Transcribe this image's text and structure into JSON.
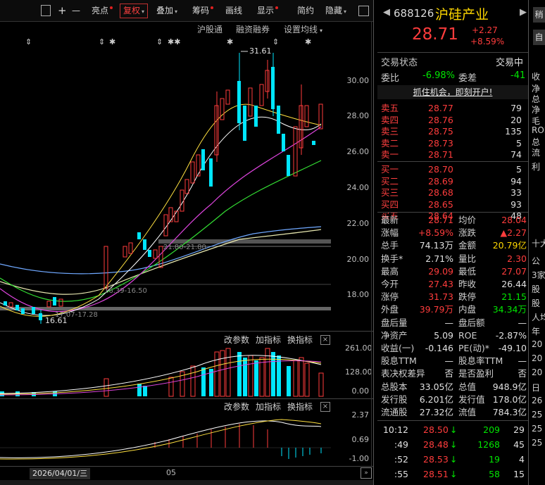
{
  "toolbar": {
    "items": [
      "亮点",
      "复权",
      "叠加",
      "筹码",
      "画线",
      "显示",
      "简约",
      "隐藏"
    ],
    "zoom_in": "+",
    "zoom_out": "—"
  },
  "chart_header": {
    "links": [
      "沪股通",
      "融资融券",
      "设置均线"
    ]
  },
  "axis": {
    "main": [
      "30.00",
      "28.00",
      "26.00",
      "24.00",
      "22.00",
      "20.00",
      "18.00"
    ],
    "vol": [
      "261.00",
      "128.00",
      "0.00"
    ],
    "macd": [
      "2.37",
      "0.69",
      "-1.00"
    ]
  },
  "annotations": {
    "high": "31.61",
    "low": "16.61",
    "level1": "21.80-21.80",
    "level2": "16.39-16.50",
    "level3": "17.07-17.28"
  },
  "sub1": {
    "tabs": [
      "改参数",
      "加指标",
      "换指标"
    ]
  },
  "sub2": {
    "tabs": [
      "改参数",
      "加指标",
      "换指标"
    ]
  },
  "date_axis": {
    "date": "2026/04/01/三",
    "month": "05"
  },
  "stock": {
    "code": "688126",
    "name": "沪硅产业",
    "price": "28.71",
    "change": "+2.27",
    "change_pct": "+8.59%",
    "status_label": "交易状态",
    "status": "交易中",
    "weibi_label": "委比",
    "weibi": "-6.98%",
    "weicha_label": "委差",
    "weicha": "-41",
    "promo": "抓住机会，即刻开户!"
  },
  "order_book": {
    "asks": [
      {
        "label": "卖五",
        "price": "28.77",
        "vol": "79"
      },
      {
        "label": "卖四",
        "price": "28.76",
        "vol": "20"
      },
      {
        "label": "卖三",
        "price": "28.75",
        "vol": "135"
      },
      {
        "label": "卖二",
        "price": "28.73",
        "vol": "5"
      },
      {
        "label": "卖一",
        "price": "28.71",
        "vol": "74"
      }
    ],
    "bids": [
      {
        "label": "买一",
        "price": "28.70",
        "vol": "5"
      },
      {
        "label": "买二",
        "price": "28.69",
        "vol": "94"
      },
      {
        "label": "买三",
        "price": "28.68",
        "vol": "33"
      },
      {
        "label": "买四",
        "price": "28.65",
        "vol": "93"
      },
      {
        "label": "买五",
        "price": "28.64",
        "vol": "48"
      }
    ]
  },
  "quote": [
    {
      "l1": "最新",
      "v1": "28.71",
      "c1": "red",
      "l2": "均价",
      "v2": "28.04",
      "c2": "red"
    },
    {
      "l1": "涨幅",
      "v1": "+8.59%",
      "c1": "red",
      "l2": "涨跌",
      "v2": "▲2.27",
      "c2": "red"
    },
    {
      "l1": "总手",
      "v1": "74.13万",
      "c1": "white",
      "l2": "金额",
      "v2": "20.79亿",
      "c2": "yellow"
    },
    {
      "l1": "换手*",
      "v1": "2.71%",
      "c1": "white",
      "l2": "量比",
      "v2": "2.30",
      "c2": "red"
    },
    {
      "l1": "最高",
      "v1": "29.09",
      "c1": "red",
      "l2": "最低",
      "v2": "27.07",
      "c2": "red"
    },
    {
      "l1": "今开",
      "v1": "27.43",
      "c1": "red",
      "l2": "昨收",
      "v2": "26.44",
      "c2": "white"
    },
    {
      "l1": "涨停",
      "v1": "31.73",
      "c1": "red",
      "l2": "跌停",
      "v2": "21.15",
      "c2": "green"
    },
    {
      "l1": "外盘",
      "v1": "39.79万",
      "c1": "red",
      "l2": "内盘",
      "v2": "34.34万",
      "c2": "green"
    },
    {
      "l1": "盘后量",
      "v1": "—",
      "c1": "white",
      "l2": "盘后额",
      "v2": "—",
      "c2": "white"
    },
    {
      "l1": "净资产",
      "v1": "5.09",
      "c1": "white",
      "l2": "ROE",
      "v2": "-2.87%",
      "c2": "white"
    },
    {
      "l1": "收益(一)",
      "v1": "-0.146",
      "c1": "white",
      "l2": "PE(动)*",
      "v2": "-49.10",
      "c2": "white"
    },
    {
      "l1": "股息TTM",
      "v1": "—",
      "c1": "white",
      "l2": "股息率TTM",
      "v2": "—",
      "c2": "white"
    },
    {
      "l1": "表决权差异",
      "v1": "否",
      "c1": "white",
      "l2": "是否盈利",
      "v2": "否",
      "c2": "white"
    },
    {
      "l1": "总股本",
      "v1": "33.05亿",
      "c1": "white",
      "l2": "总值",
      "v2": "948.9亿",
      "c2": "white"
    },
    {
      "l1": "发行股",
      "v1": "6.201亿",
      "c1": "white",
      "l2": "发行值",
      "v2": "178.0亿",
      "c2": "white"
    },
    {
      "l1": "流通股",
      "v1": "27.32亿",
      "c1": "white",
      "l2": "流值",
      "v2": "784.3亿",
      "c2": "white"
    }
  ],
  "ticks": [
    {
      "time": "10:12",
      "price": "28.50",
      "vol": "209",
      "n": "29"
    },
    {
      "time": ":49",
      "price": "28.48",
      "vol": "1268",
      "n": "45"
    },
    {
      "time": ":52",
      "price": "28.53",
      "vol": "19",
      "n": "4"
    },
    {
      "time": ":55",
      "price": "28.51",
      "vol": "58",
      "n": "15"
    }
  ],
  "right_strip": [
    "收",
    "净",
    "总",
    "净",
    "毛",
    "ROE",
    "总",
    "流",
    "利",
    "十大",
    "公",
    "3家",
    "股",
    "股",
    "人均",
    "年",
    "20",
    "20",
    "20",
    "日",
    "26",
    "25",
    "25",
    "25"
  ],
  "colors": {
    "up": "#ff3c3c",
    "down": "#00e6ff",
    "bg": "#000000",
    "accent": "#ffd800"
  }
}
